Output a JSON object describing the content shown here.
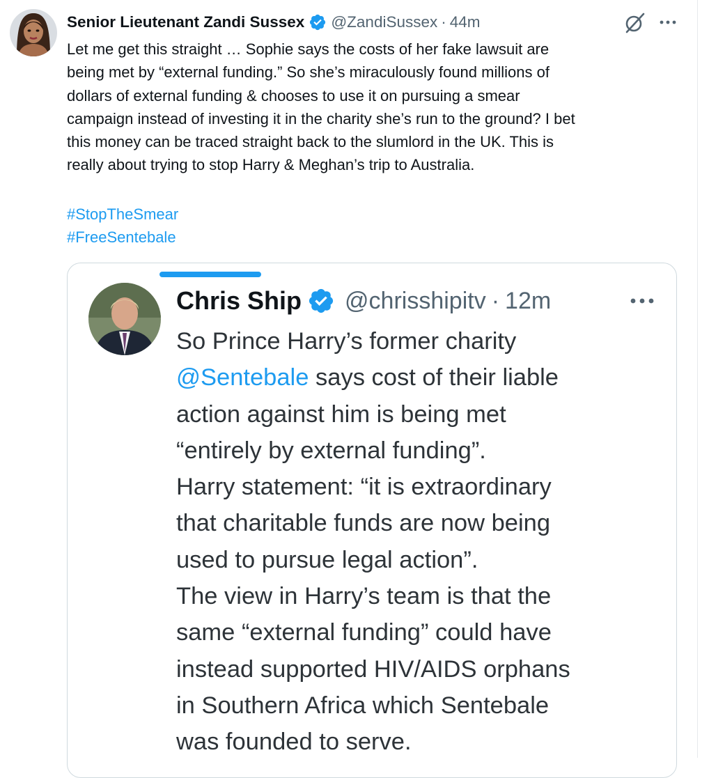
{
  "tweet": {
    "author_name": "Senior Lieutenant Zandi Sussex",
    "handle": "@ZandiSussex",
    "separator": "·",
    "time": "44m",
    "icons": {
      "avatar": "profile-avatar",
      "verified": "verified-badge-icon",
      "grok": "grok-icon",
      "more": "more-options-icon"
    },
    "text_lines": [
      "Let me get this straight … Sophie says the costs of her fake lawsuit are",
      "being met by “external funding.” So she’s miraculously found millions of",
      "dollars of external funding & chooses to use it on pursuing a smear",
      "campaign instead of investing it in the charity she’s run to the ground? I bet",
      "this money can be traced straight back to the slumlord in the UK. This is",
      "really about trying to stop Harry & Meghan’s trip to Australia."
    ],
    "hashtags": [
      "#StopTheSmear",
      "#FreeSentebale"
    ]
  },
  "quote": {
    "author_name": "Chris Ship",
    "handle": "@chrisshipitv",
    "separator": "·",
    "time": "12m",
    "mention": "@Sentebale",
    "line1": "So Prince Harry’s former charity",
    "line2_after_mention": " says cost of their liable",
    "lines_rest": [
      "action against him is being met",
      "“entirely by external funding”.",
      "Harry statement: “it is extraordinary",
      "that charitable funds are now being",
      "used to pursue legal action”.",
      "The view in Harry’s team is that the",
      "same “external funding” could have",
      "instead supported HIV/AIDS orphans",
      "in Southern Africa which Sentebale",
      "was founded to serve."
    ]
  },
  "colors": {
    "text": "#0f1419",
    "secondary": "#536471",
    "link": "#1d9bf0",
    "border": "#cfd9de",
    "verified": "#1d9bf0"
  }
}
